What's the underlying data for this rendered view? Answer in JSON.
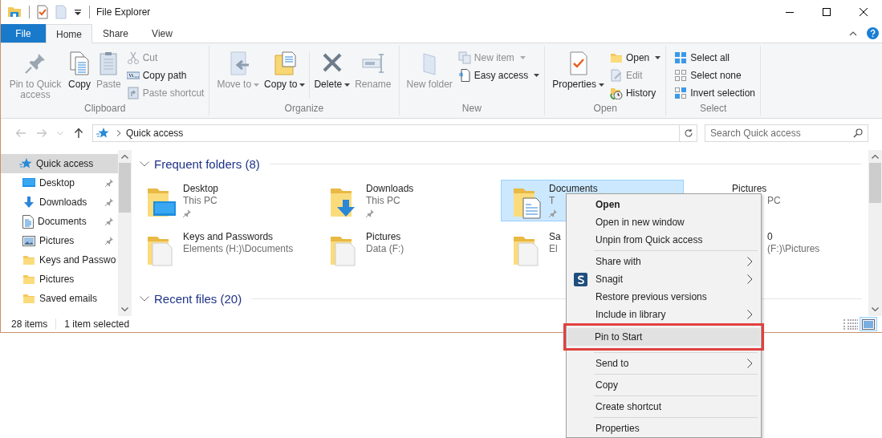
{
  "window": {
    "title": "File Explorer"
  },
  "ribbon_tabs": [
    {
      "label": "File",
      "kind": "file",
      "selected": false
    },
    {
      "label": "Home",
      "kind": "tab",
      "selected": true
    },
    {
      "label": "Share",
      "kind": "tab",
      "selected": false
    },
    {
      "label": "View",
      "kind": "tab",
      "selected": false
    }
  ],
  "ribbon_groups": [
    {
      "label": "Clipboard",
      "large": [
        {
          "label": "Pin to Quick access",
          "disabled": true,
          "dropdown": false
        },
        {
          "label": "Copy",
          "disabled": false,
          "dropdown": false
        },
        {
          "label": "Paste",
          "disabled": true,
          "dropdown": false
        }
      ],
      "small": [
        {
          "label": "Cut",
          "disabled": true,
          "dropdown": false
        },
        {
          "label": "Copy path",
          "disabled": false,
          "dropdown": false
        },
        {
          "label": "Paste shortcut",
          "disabled": true,
          "dropdown": false
        }
      ]
    },
    {
      "label": "Organize",
      "large": [
        {
          "label": "Move to",
          "disabled": true,
          "dropdown": true
        },
        {
          "label": "Copy to",
          "disabled": false,
          "dropdown": true
        },
        {
          "label": "Delete",
          "disabled": false,
          "dropdown": true
        },
        {
          "label": "Rename",
          "disabled": true,
          "dropdown": false
        }
      ]
    },
    {
      "label": "New",
      "large": [
        {
          "label": "New folder",
          "disabled": true,
          "dropdown": false
        }
      ],
      "small": [
        {
          "label": "New item",
          "disabled": true,
          "dropdown": true
        },
        {
          "label": "Easy access",
          "disabled": false,
          "dropdown": true
        }
      ]
    },
    {
      "label": "Open",
      "large": [
        {
          "label": "Properties",
          "disabled": false,
          "dropdown": true
        }
      ],
      "small": [
        {
          "label": "Open",
          "disabled": false,
          "dropdown": true
        },
        {
          "label": "Edit",
          "disabled": true,
          "dropdown": false
        },
        {
          "label": "History",
          "disabled": false,
          "dropdown": false
        }
      ]
    },
    {
      "label": "Select",
      "small": [
        {
          "label": "Select all",
          "disabled": false,
          "dropdown": false
        },
        {
          "label": "Select none",
          "disabled": false,
          "dropdown": false
        },
        {
          "label": "Invert selection",
          "disabled": false,
          "dropdown": false
        }
      ]
    }
  ],
  "address_bar": {
    "path": "Quick access"
  },
  "search": {
    "placeholder": "Search Quick access"
  },
  "navigation_pane": [
    {
      "label": "Quick access",
      "selected": true,
      "pinned": false
    },
    {
      "label": "Desktop",
      "selected": false,
      "pinned": true
    },
    {
      "label": "Downloads",
      "selected": false,
      "pinned": true
    },
    {
      "label": "Documents",
      "selected": false,
      "pinned": true
    },
    {
      "label": "Pictures",
      "selected": false,
      "pinned": true
    },
    {
      "label": "Keys and Passwo",
      "selected": false,
      "pinned": false
    },
    {
      "label": "Pictures",
      "selected": false,
      "pinned": false
    },
    {
      "label": "Saved emails",
      "selected": false,
      "pinned": false
    }
  ],
  "sections": [
    {
      "title": "Frequent folders (8)",
      "expanded": true,
      "items": [
        {
          "name": "Desktop",
          "location": "This PC",
          "pinned": true,
          "selected": false
        },
        {
          "name": "Downloads",
          "location": "This PC",
          "pinned": true,
          "selected": false
        },
        {
          "name": "Documents",
          "location": "T",
          "pinned": true,
          "selected": true
        },
        {
          "name": "Pictures",
          "location": "PC",
          "pinned": false,
          "selected": false
        },
        {
          "name": "Keys and Passwords",
          "location": "Elements (H:)\\Documents",
          "pinned": false,
          "selected": false
        },
        {
          "name": "Pictures",
          "location": "Data (F:)",
          "pinned": false,
          "selected": false
        },
        {
          "name": "Sa",
          "location": "El",
          "pinned": false,
          "selected": false
        },
        {
          "name": "0",
          "location": "(F:)\\Pictures",
          "pinned": false,
          "selected": false
        }
      ]
    },
    {
      "title": "Recent files (20)",
      "expanded": true
    }
  ],
  "status_bar": {
    "item_count": "28 items",
    "selection": "1 item selected",
    "view_buttons": [
      {
        "selected": false
      },
      {
        "selected": true
      }
    ]
  },
  "context_menu": {
    "groups": [
      {
        "items": [
          {
            "label": "Open",
            "default": true,
            "submenu": false,
            "highlighted": false,
            "annotated": false
          },
          {
            "label": "Open in new window",
            "default": false,
            "submenu": false,
            "highlighted": false,
            "annotated": false
          },
          {
            "label": "Unpin from Quick access",
            "default": false,
            "submenu": false,
            "highlighted": false,
            "annotated": false
          }
        ]
      },
      {
        "items": [
          {
            "label": "Share with",
            "default": false,
            "submenu": true,
            "highlighted": false,
            "annotated": false
          },
          {
            "label": "Snagit",
            "default": false,
            "submenu": true,
            "highlighted": false,
            "annotated": false
          },
          {
            "label": "Restore previous versions",
            "default": false,
            "submenu": false,
            "highlighted": false,
            "annotated": false
          },
          {
            "label": "Include in library",
            "default": false,
            "submenu": true,
            "highlighted": false,
            "annotated": false
          },
          {
            "label": "Pin to Start",
            "default": false,
            "submenu": false,
            "highlighted": true,
            "annotated": true
          }
        ]
      },
      {
        "items": [
          {
            "label": "Send to",
            "default": false,
            "submenu": true,
            "highlighted": false,
            "annotated": false
          }
        ]
      },
      {
        "items": [
          {
            "label": "Copy",
            "default": false,
            "submenu": false,
            "highlighted": false,
            "annotated": false
          }
        ]
      },
      {
        "items": [
          {
            "label": "Create shortcut",
            "default": false,
            "submenu": false,
            "highlighted": false,
            "annotated": false
          }
        ]
      },
      {
        "items": [
          {
            "label": "Properties",
            "default": false,
            "submenu": false,
            "highlighted": false,
            "annotated": false
          }
        ]
      }
    ]
  }
}
